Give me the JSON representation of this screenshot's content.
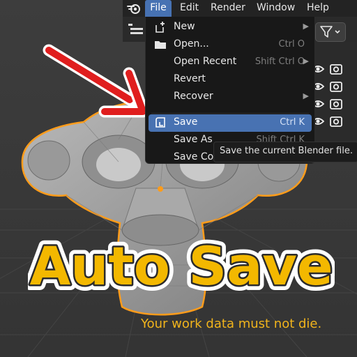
{
  "menubar": {
    "items": [
      {
        "label": "File"
      },
      {
        "label": "Edit"
      },
      {
        "label": "Render"
      },
      {
        "label": "Window"
      },
      {
        "label": "Help"
      }
    ]
  },
  "file_menu": {
    "items": [
      {
        "label": "New",
        "shortcut": "",
        "icon": "new-file-icon",
        "submenu": true
      },
      {
        "label": "Open...",
        "shortcut": "Ctrl O",
        "icon": "folder-icon",
        "submenu": false
      },
      {
        "label": "Open Recent",
        "shortcut": "Shift Ctrl O",
        "icon": "",
        "submenu": true
      },
      {
        "label": "Revert",
        "shortcut": "",
        "icon": "",
        "submenu": false
      },
      {
        "label": "Recover",
        "shortcut": "",
        "icon": "",
        "submenu": true
      },
      {
        "label": "Save",
        "shortcut": "Ctrl K",
        "icon": "save-icon",
        "submenu": false
      },
      {
        "label": "Save As",
        "shortcut": "Shift Ctrl K",
        "icon": "",
        "submenu": false
      },
      {
        "label": "Save Co",
        "shortcut": "",
        "icon": "",
        "submenu": false
      }
    ]
  },
  "tooltip": {
    "text": "Save the current Blender file."
  },
  "overlay": {
    "headline": "Auto Save",
    "tagline": "Your work data must not die."
  },
  "colors": {
    "accent": "#4772b3",
    "headline_fill": "#f3b800",
    "tagline": "#f1b41c",
    "arrow": "#e01e1e",
    "selection_outline": "#ff9c1a"
  }
}
